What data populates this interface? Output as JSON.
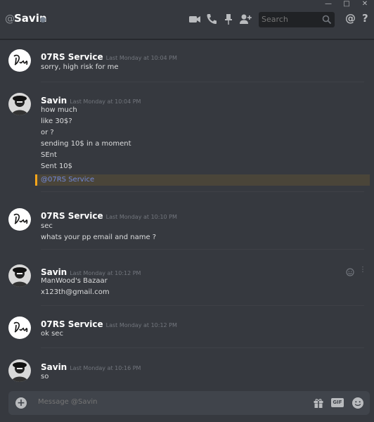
{
  "header": {
    "title": "Savin",
    "search_placeholder": "Search"
  },
  "messages": [
    {
      "author": "07RS Service",
      "timestamp": "Last Monday at 10:04 PM",
      "lines": [
        "sorry, high risk for me"
      ]
    },
    {
      "author": "Savin",
      "timestamp": "Last Monday at 10:04 PM",
      "lines": [
        "how much",
        "like 30$?",
        "or ?",
        "sending 10$ in a moment",
        "SEnt",
        "Sent 10$"
      ],
      "mention": "@07RS Service"
    },
    {
      "author": "07RS Service",
      "timestamp": "Last Monday at 10:10 PM",
      "lines": [
        "sec",
        "whats your pp email and name ?"
      ]
    },
    {
      "author": "Savin",
      "timestamp": "Last Monday at 10:12 PM",
      "lines": [
        "ManWood's Bazaar",
        "x123th@gmail.com"
      ]
    },
    {
      "author": "07RS Service",
      "timestamp": "Last Monday at 10:12 PM",
      "lines": [
        "ok sec"
      ]
    },
    {
      "author": "Savin",
      "timestamp": "Last Monday at 10:16 PM",
      "lines": [
        "so"
      ]
    }
  ],
  "composer": {
    "placeholder": "Message @Savin",
    "gif_label": "GIF"
  },
  "colors": {
    "background": "#36393f",
    "mention_accent": "#faa61a",
    "mention_text": "#7289da"
  },
  "icons": [
    "video-call-icon",
    "voice-call-icon",
    "pin-icon",
    "add-friend-icon",
    "search-icon",
    "at-icon",
    "help-icon",
    "add-attachment-icon",
    "gift-icon",
    "emoji-icon"
  ]
}
